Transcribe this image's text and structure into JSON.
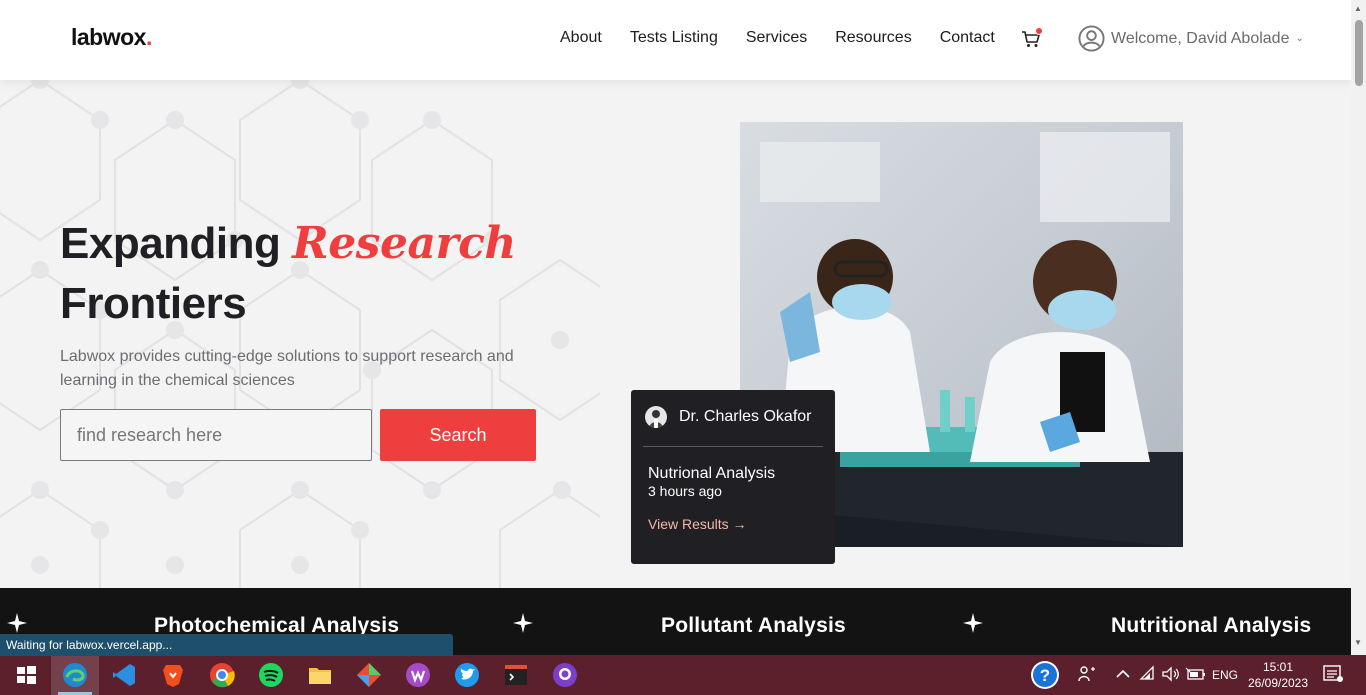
{
  "header": {
    "logo_text": "labwox",
    "logo_dot": ".",
    "nav": [
      "About",
      "Tests Listing",
      "Services",
      "Resources",
      "Contact"
    ],
    "welcome": "Welcome, David Abolade"
  },
  "hero": {
    "title_part1": "Expanding ",
    "title_accent": "Research",
    "title_part2": "Frontiers",
    "description": "Labwox provides cutting-edge solutions to support research and learning in the chemical sciences",
    "search_placeholder": "find research here",
    "search_button": "Search"
  },
  "card": {
    "doctor": "Dr. Charles Okafor",
    "analysis": "Nutrional Analysis",
    "time": "3 hours ago",
    "link": "View Results →"
  },
  "strip": {
    "items": [
      "Photochemical Analysis",
      "Pollutant Analysis",
      "Nutritional Analysis"
    ]
  },
  "status_bar": "Waiting for labwox.vercel.app...",
  "taskbar": {
    "lang": "ENG",
    "time": "15:01",
    "date": "26/09/2023"
  },
  "colors": {
    "accent": "#ef3e3e",
    "dark": "#1f1f24",
    "taskbar": "#5c1f2c"
  }
}
